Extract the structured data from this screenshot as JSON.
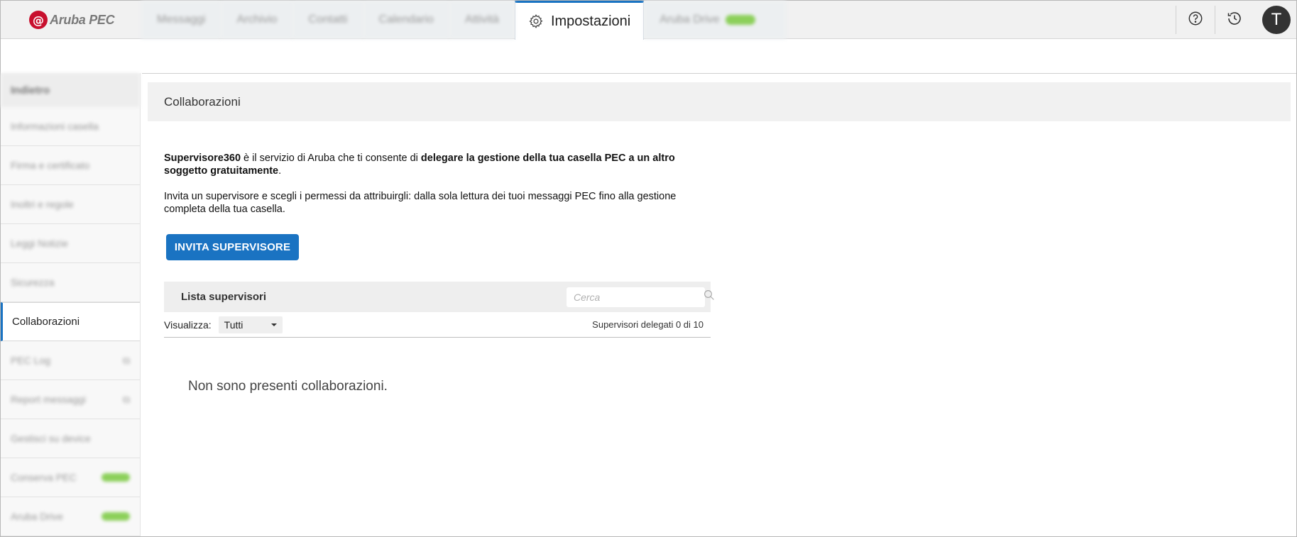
{
  "app": {
    "logo_text": "Aruba PEC",
    "logo_mark": "@"
  },
  "nav": {
    "tabs": [
      {
        "label": "Messaggi"
      },
      {
        "label": "Archivio"
      },
      {
        "label": "Contatti"
      },
      {
        "label": "Calendario"
      },
      {
        "label": "Attività"
      },
      {
        "label": "Impostazioni",
        "active": true,
        "icon": "gear-icon"
      },
      {
        "label": "Aruba Drive"
      }
    ]
  },
  "top_right": {
    "help_icon": "help-icon",
    "history_icon": "history-icon",
    "avatar_initial": "T"
  },
  "sidebar": {
    "header": "Indietro",
    "items": [
      {
        "label": "Informazioni casella"
      },
      {
        "label": "Firma e certificato"
      },
      {
        "label": "Inoltri e regole"
      },
      {
        "label": "Leggi Notizie"
      },
      {
        "label": "Sicurezza"
      },
      {
        "label": "Collaborazioni",
        "active": true
      },
      {
        "label": "PEC Log"
      },
      {
        "label": "Report messaggi"
      },
      {
        "label": "Gestisci su device"
      },
      {
        "label": "Conserva PEC"
      },
      {
        "label": "Aruba Drive"
      }
    ]
  },
  "main": {
    "title": "Collaborazioni",
    "intro_strong1": "Supervisore360",
    "intro_text1": " è il servizio di Aruba che ti consente di ",
    "intro_strong2": "delegare la gestione della tua casella PEC a un altro soggetto gratuitamente",
    "intro_text2": ".",
    "intro_p2": "Invita un supervisore e scegli i permessi da attribuirgli: dalla sola lettura dei tuoi messaggi PEC fino alla gestione completa della tua casella.",
    "invite_button": "INVITA SUPERVISORE",
    "list": {
      "title": "Lista supervisori",
      "search_placeholder": "Cerca",
      "filter_label": "Visualizza:",
      "filter_value": "Tutti",
      "count_text": "Supervisori delegati 0 di 10",
      "empty_message": "Non sono presenti collaborazioni."
    }
  },
  "colors": {
    "accent": "#1a73c2",
    "brand_red": "#c8102e",
    "badge_green": "#8cd05a"
  }
}
